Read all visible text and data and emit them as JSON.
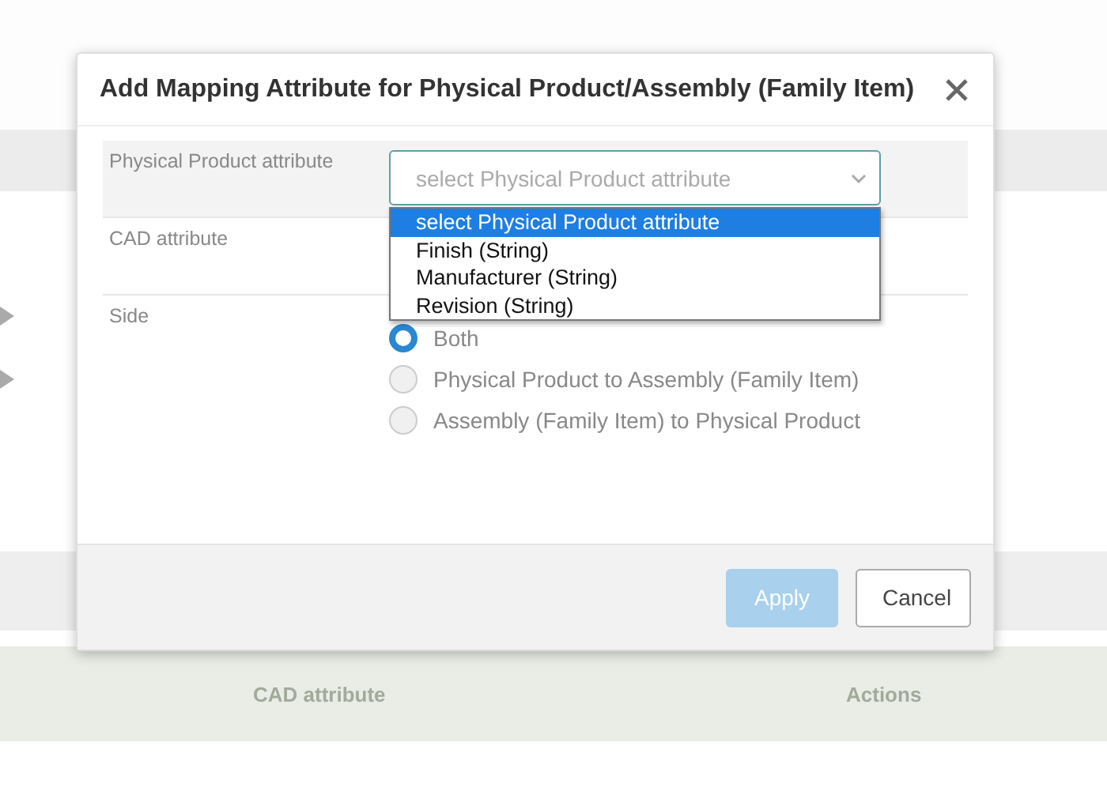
{
  "background": {
    "rows": [
      {
        "expanded": false
      },
      {
        "expanded": false
      }
    ],
    "table_header": [
      "CAD attribute",
      "Actions"
    ]
  },
  "dialog": {
    "title": "Add Mapping Attribute for Physical Product/Assembly (Family Item)",
    "fields": [
      {
        "kind": "select",
        "label": "Physical Product attribute",
        "placeholder": "select Physical Product attribute",
        "open": true,
        "options": [
          {
            "label": "select Physical Product attribute",
            "selected": true
          },
          {
            "label": "Finish (String)",
            "selected": false
          },
          {
            "label": "Manufacturer (String)",
            "selected": false
          },
          {
            "label": "Revision (String)",
            "selected": false
          }
        ]
      },
      {
        "kind": "empty",
        "label": "CAD attribute"
      },
      {
        "kind": "radio",
        "label": "Side",
        "options": [
          {
            "label": "Both",
            "selected": true
          },
          {
            "label": "Physical Product to Assembly (Family Item)",
            "selected": false
          },
          {
            "label": "Assembly (Family Item) to Physical Product",
            "selected": false
          }
        ]
      }
    ],
    "buttons": [
      {
        "label": "Apply",
        "kind": "primary",
        "disabled": true
      },
      {
        "label": "Cancel",
        "kind": "default",
        "disabled": false
      }
    ]
  }
}
